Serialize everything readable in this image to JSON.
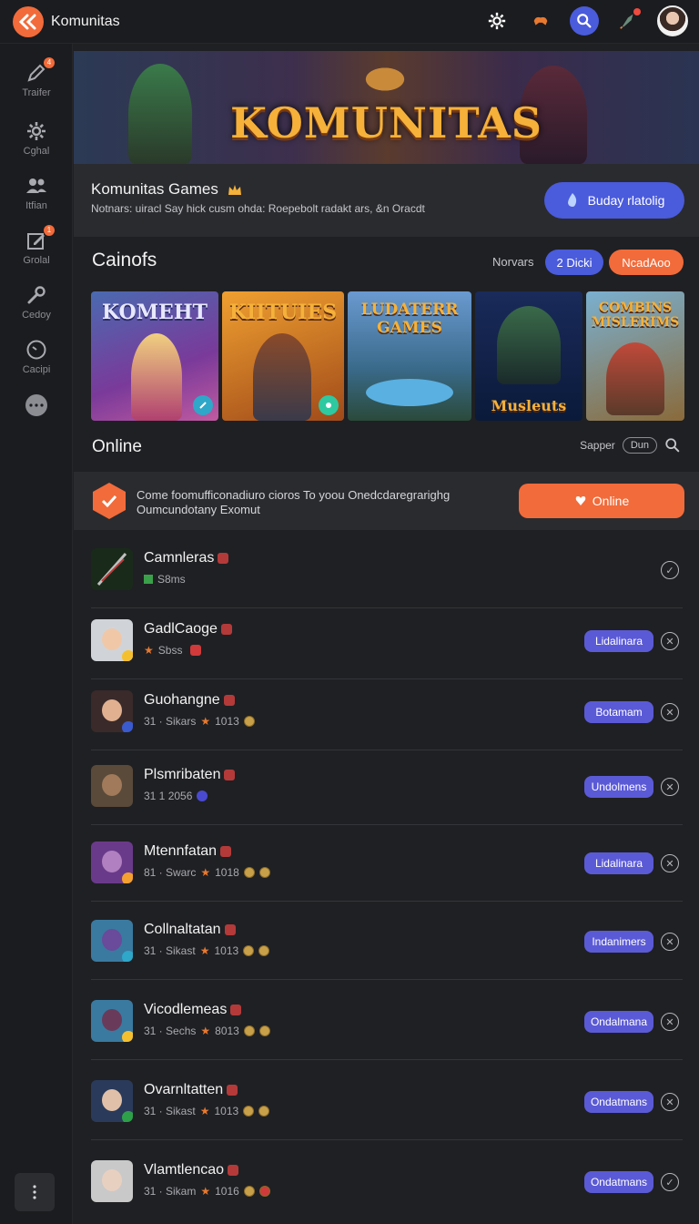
{
  "app": {
    "title": "Komunitas"
  },
  "sidebar": {
    "items": [
      {
        "label": "Traifer",
        "icon": "pencil-icon",
        "badge": "4"
      },
      {
        "label": "Cghal",
        "icon": "gear-icon"
      },
      {
        "label": "Itfian",
        "icon": "users-icon"
      },
      {
        "label": "Grolal",
        "icon": "edit-icon",
        "badge": "1"
      },
      {
        "label": "Cedoy",
        "icon": "wrench-icon"
      },
      {
        "label": "Cacipi",
        "icon": "clock-icon"
      }
    ]
  },
  "banner": {
    "title": "KOMUNITAS"
  },
  "community": {
    "name": "Komunitas Games",
    "description": "Notnars: uiracl Say hick cusm ohda: Roepebolt radakt ars, &n Oracdt",
    "cta_label": "Buday rlatolig"
  },
  "games_section": {
    "title": "Cainofs",
    "filter_label": "Norvars",
    "chip_primary": "2 Dicki",
    "chip_secondary": "NcadAoo",
    "cards": [
      {
        "label": "KOMEHT"
      },
      {
        "label": "KIITUIES"
      },
      {
        "label": "LUDATERR GAMES"
      },
      {
        "label": "Musleuts"
      },
      {
        "label": "COMBINS MISLERIMS"
      }
    ]
  },
  "online_section": {
    "title": "Online",
    "sort_label": "Sapper",
    "pill_label": "Dun"
  },
  "promo": {
    "text_line1": "Come foomufficonadiuro cioros To yoou Onedcdaregrarighg",
    "text_line2": "Oumcundotany Exomut",
    "button_label": "Online"
  },
  "users": [
    {
      "name": "Camnleras",
      "sub": "S8ms",
      "action": "",
      "avatar_color": "#2f4a3a"
    },
    {
      "name": "GadlCaoge",
      "sub": "Sbss",
      "action": "Lidalinara",
      "avatar_color": "#c7c9cc"
    },
    {
      "name": "Guohangne",
      "sub": "31 · Sikars",
      "score": "1013",
      "action": "Botamam",
      "avatar_color": "#6b4a3a"
    },
    {
      "name": "Plsmribaten",
      "sub": "31 1 2056",
      "action": "Undolmens",
      "avatar_color": "#5a4a3a"
    },
    {
      "name": "Mtennfatan",
      "sub": "81 · Swarc",
      "score": "1018",
      "action": "Lidalinara",
      "avatar_color": "#6a3a8a"
    },
    {
      "name": "Collnaltatan",
      "sub": "31 · Sikast",
      "score": "1013",
      "action": "Indanimers",
      "avatar_color": "#3a6a8a"
    },
    {
      "name": "Vicodlemeas",
      "sub": "31 · Sechs",
      "score": "8013",
      "action": "Ondalmana",
      "avatar_color": "#3a6a8a"
    },
    {
      "name": "Ovarnltatten",
      "sub": "31 · Sikast",
      "score": "1013",
      "action": "Ondatmans",
      "avatar_color": "#2a3a5a"
    },
    {
      "name": "Vlamtlencao",
      "sub": "31 · Sikam",
      "score": "1016",
      "action": "Ondatmans",
      "avatar_color": "#c9c9c9"
    }
  ],
  "colors": {
    "accent_orange": "#f26b3a",
    "accent_blue": "#4a5bdc",
    "action_purple": "#5b5ad6",
    "background": "#1f2023"
  }
}
